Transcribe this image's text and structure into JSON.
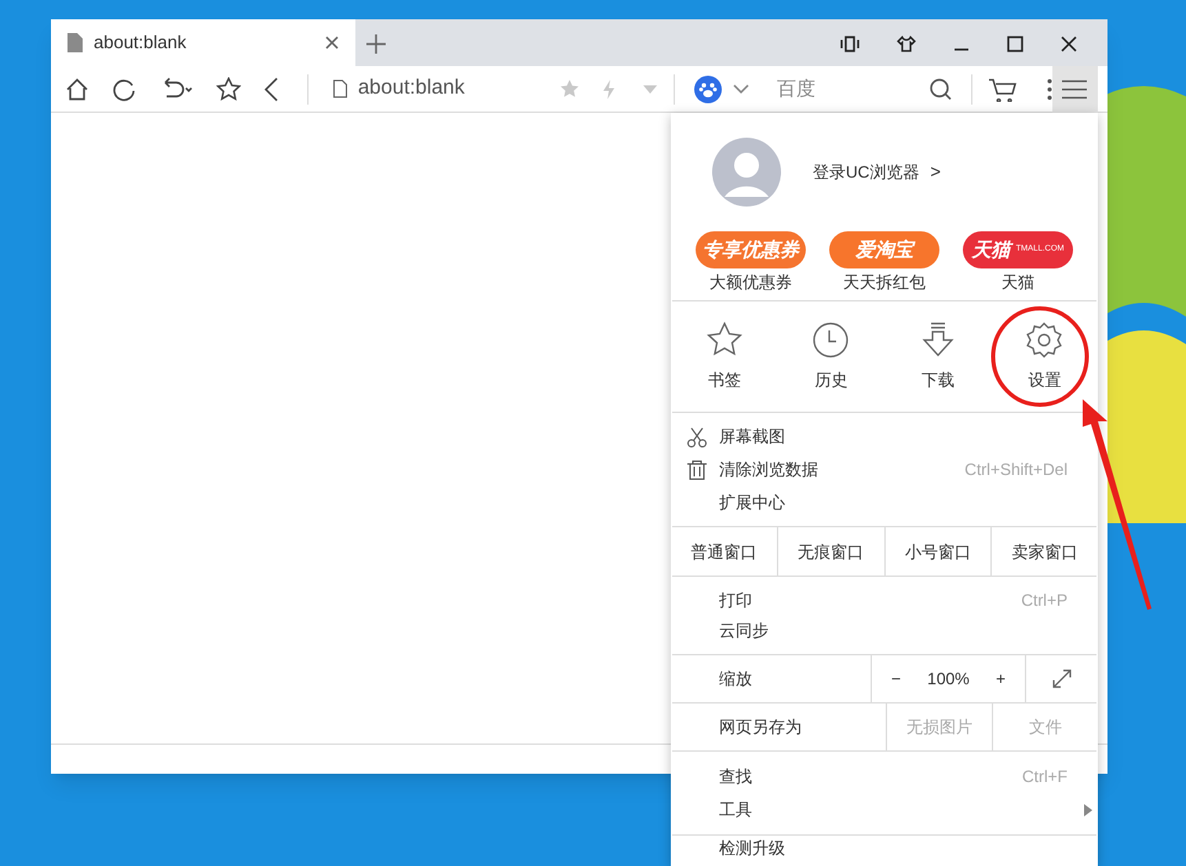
{
  "tab": {
    "title": "about:blank",
    "selected": true
  },
  "address": {
    "value": "about:blank"
  },
  "search": {
    "engine": "百度"
  },
  "menu_button": {
    "active": true
  },
  "menu": {
    "profile": {
      "login": "登录UC浏览器",
      "chevron": ">"
    },
    "promos": [
      {
        "badge": "专享优惠券",
        "label": "大额优惠券",
        "color": "#f5742f"
      },
      {
        "badge": "爱淘宝",
        "label": "天天拆红包",
        "color": "#f7752c"
      },
      {
        "badge": "天猫",
        "badge_sub": "TMALL.COM",
        "label": "天猫",
        "color": "#e8303b"
      }
    ],
    "quick": [
      {
        "kind": "star",
        "label": "书签"
      },
      {
        "kind": "clock",
        "label": "历史"
      },
      {
        "kind": "download",
        "label": "下载"
      },
      {
        "kind": "gear",
        "label": "设置"
      }
    ],
    "tools": [
      {
        "kind": "scissors",
        "label": "屏幕截图"
      },
      {
        "kind": "trash",
        "label": "清除浏览数据",
        "shortcut": "Ctrl+Shift+Del"
      },
      {
        "kind": "none",
        "label": "扩展中心"
      }
    ],
    "windows": [
      "普通窗口",
      "无痕窗口",
      "小号窗口",
      "卖家窗口"
    ],
    "print": [
      {
        "label": "打印",
        "shortcut": "Ctrl+P"
      },
      {
        "label": "云同步"
      }
    ],
    "zoom": {
      "label": "缩放",
      "minus": "−",
      "value": "100%",
      "plus": "+"
    },
    "save": {
      "label": "网页另存为",
      "options": [
        "无损图片",
        "文件"
      ]
    },
    "find": [
      {
        "label": "查找",
        "shortcut": "Ctrl+F",
        "submenu": false
      },
      {
        "label": "工具",
        "submenu": true
      }
    ],
    "last": "检测升级"
  }
}
